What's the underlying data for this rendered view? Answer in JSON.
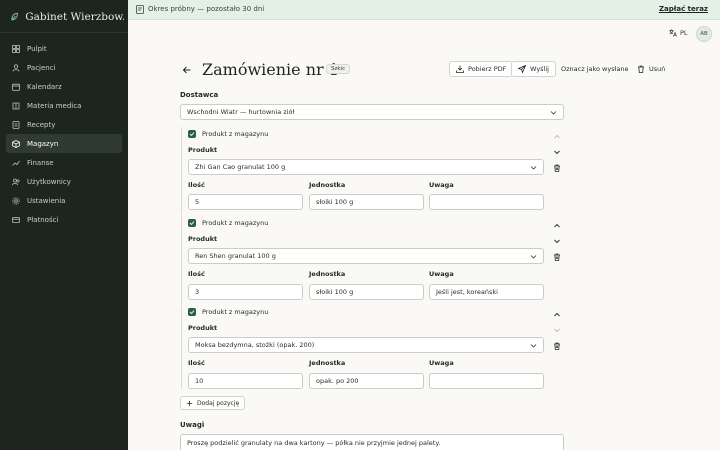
{
  "app": {
    "title": "Gabinet Wierzbow..."
  },
  "sidebar": {
    "items": [
      {
        "label": "Pulpit",
        "icon": "dashboard-icon",
        "active": false
      },
      {
        "label": "Pacjenci",
        "icon": "patients-icon",
        "active": false
      },
      {
        "label": "Kalendarz",
        "icon": "calendar-icon",
        "active": false
      },
      {
        "label": "Materia medica",
        "icon": "book-icon",
        "active": false
      },
      {
        "label": "Recepty",
        "icon": "prescription-icon",
        "active": false
      },
      {
        "label": "Magazyn",
        "icon": "box-icon",
        "active": true
      },
      {
        "label": "Finanse",
        "icon": "finance-icon",
        "active": false
      },
      {
        "label": "Użytkownicy",
        "icon": "users-icon",
        "active": false
      },
      {
        "label": "Ustawienia",
        "icon": "gear-icon",
        "active": false
      },
      {
        "label": "Płatności",
        "icon": "card-icon",
        "active": false
      }
    ]
  },
  "banner": {
    "text": "Okres próbny — pozostało 30 dni",
    "link": "Zapłać teraz"
  },
  "topbar": {
    "language": "PL",
    "avatar_initials": "AB"
  },
  "page": {
    "title": "Zamówienie nr 1",
    "status_badge": "Szkic",
    "actions": {
      "pdf": "Pobierz PDF",
      "send": "Wyślij",
      "mark_sent": "Oznacz jako wysłane",
      "delete": "Usuń"
    }
  },
  "supplier": {
    "label": "Dostawca",
    "value": "Wschodni Wiatr — hurtownia ziół"
  },
  "labels": {
    "from_stock": "Produkt z magazynu",
    "product": "Produkt",
    "qty": "Ilość",
    "unit": "Jednostka",
    "note": "Uwaga"
  },
  "positions": [
    {
      "from_stock": true,
      "product": "Zhi Gan Cao granulat 100 g",
      "qty": "5",
      "unit": "słoiki 100 g",
      "note": ""
    },
    {
      "from_stock": true,
      "product": "Ren Shen granulat 100 g",
      "qty": "3",
      "unit": "słoiki 100 g",
      "note": "Jeśli jest, koreański"
    },
    {
      "from_stock": true,
      "product": "Moksa bezdymna, stożki (opak. 200)",
      "qty": "10",
      "unit": "opak. po 200",
      "note": ""
    }
  ],
  "add_position": "Dodaj pozycję",
  "notes": {
    "label": "Uwagi",
    "value": "Proszę podzielić granulaty na dwa kartony — półka nie przyjmie jednej palety."
  },
  "colors": {
    "sidebar_bg": "#1d2521",
    "accent": "#2f5d43",
    "banner_bg": "#e4efe6"
  }
}
